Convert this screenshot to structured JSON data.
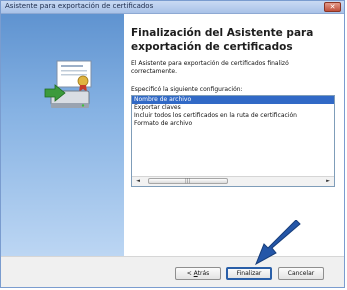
{
  "window": {
    "title": "Asistente para exportación de certificados",
    "close_label": "✕"
  },
  "main": {
    "heading": "Finalización del Asistente para exportación de certificados",
    "description": "El Asistente para exportación de certificados finalizó correctamente.",
    "config_label": "Especificó la siguiente configuración:",
    "config_items": [
      "Nombre de archivo",
      "Exportar claves",
      "Incluir todos los certificados en la ruta de certificación",
      "Formato de archivo"
    ],
    "scrollbar_left": "◄",
    "scrollbar_right": "►",
    "scrollbar_thumb": "|||"
  },
  "buttons": {
    "back_prefix": "< ",
    "back_accel": "A",
    "back_rest": "trás",
    "finish": "Finalizar",
    "cancel": "Cancelar"
  },
  "colors": {
    "selection": "#3169c6",
    "panel_top": "#5f93d0",
    "arrow": "#2456a8"
  }
}
